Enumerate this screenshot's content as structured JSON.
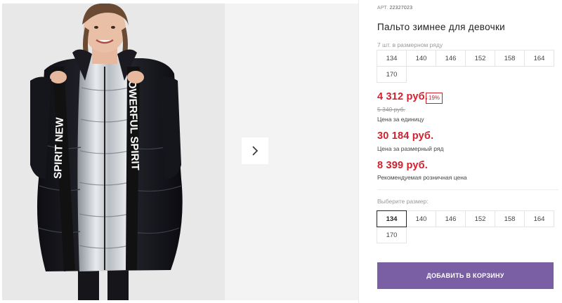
{
  "product": {
    "art_label": "АРТ.",
    "art_value": "22327023",
    "title": "Пальто зимнее для девочки",
    "pack_note": "7 шт. в размерном ряду",
    "pack_sizes": [
      "134",
      "140",
      "146",
      "152",
      "158",
      "164",
      "170"
    ],
    "price_unit": "4 312 руб.",
    "discount": "19%",
    "old_price": "5 340 руб.",
    "price_unit_caption": "Цена за единицу",
    "price_pack": "30 184 руб.",
    "price_pack_caption": "Цена за размерный ряд",
    "price_retail": "8 399 руб.",
    "price_retail_caption": "Рекомендуемая розничная цена",
    "choose_label": "Выберите размер:",
    "select_sizes": [
      "134",
      "140",
      "146",
      "152",
      "158",
      "164",
      "170"
    ],
    "selected_size": "134",
    "cart_button": "ДОБАВИТЬ В КОРЗИНУ",
    "jacket_print_left": "SPIRIT NEW",
    "jacket_print_right": "POWERFUL SPIRIT"
  },
  "colors": {
    "price_red": "#d1202e",
    "button_purple": "#7b5fa5"
  },
  "icons": {
    "next": "chevron-right-icon"
  }
}
